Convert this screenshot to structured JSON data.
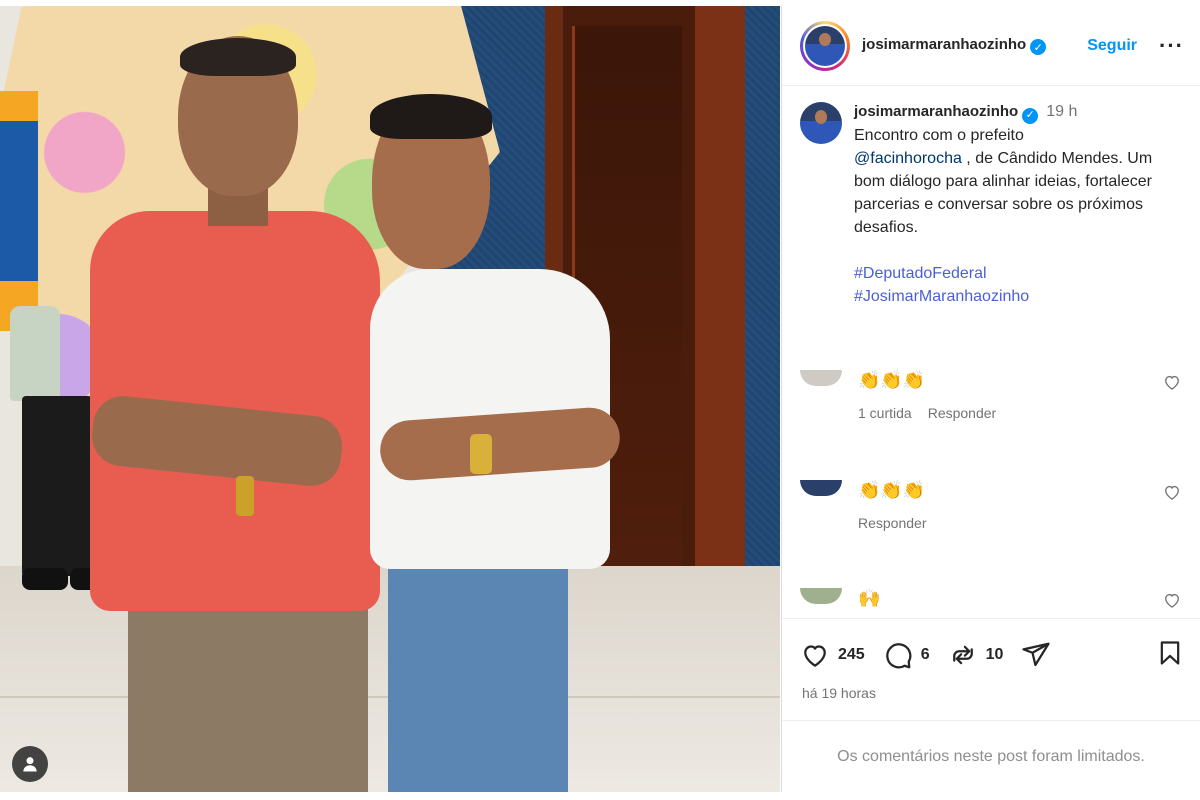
{
  "post": {
    "username": "josimarmaranhaozinho",
    "follow_label": "Seguir",
    "more_label": "···",
    "caption": {
      "username": "josimarmaranhaozinho",
      "time": "19 h",
      "line1": "Encontro com o prefeito",
      "mention": "@facinhorocha",
      "after_mention": " , de Cândido Mendes. Um bom diálogo para alinhar ideias, fortalecer parcerias e conversar sobre os próximos desafios.",
      "hashtags": [
        "#DeputadoFederal",
        "#JosimarMaranhaozinho"
      ]
    },
    "comments": [
      {
        "text": "👏👏👏",
        "meta": [
          "1 curtida",
          "Responder"
        ]
      },
      {
        "text": "👏👏👏",
        "meta": [
          "Responder"
        ]
      },
      {
        "text": "🙌",
        "meta": []
      }
    ],
    "stats": {
      "likes": "245",
      "comments": "6",
      "reposts": "10"
    },
    "posted_ago": "há 19 horas",
    "comments_limited": "Os comentários neste post foram limitados."
  },
  "colors": {
    "accent": "#0095f6",
    "hashtag": "#4a5fd7",
    "muted": "#737373"
  },
  "icons": [
    "verified-badge-icon",
    "heart-icon",
    "comment-icon",
    "repost-icon",
    "share-icon",
    "bookmark-icon",
    "user-tag-icon"
  ]
}
